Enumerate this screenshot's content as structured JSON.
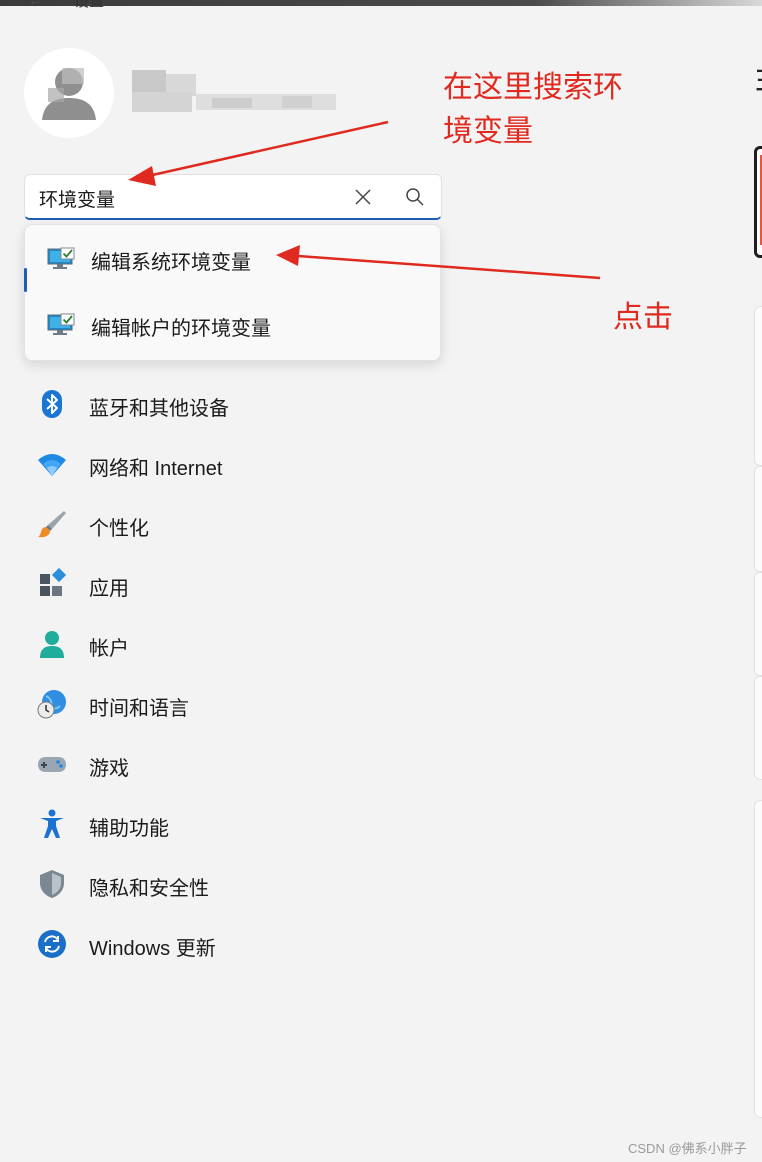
{
  "window": {
    "title": "设置"
  },
  "search": {
    "value": "环境变量"
  },
  "dropdown_results": [
    {
      "label": "编辑系统环境变量",
      "icon": "monitor-check-icon"
    },
    {
      "label": "编辑帐户的环境变量",
      "icon": "monitor-check-icon"
    }
  ],
  "nav": [
    {
      "label": "蓝牙和其他设备",
      "icon": "bluetooth-icon"
    },
    {
      "label": "网络和 Internet",
      "icon": "wifi-icon"
    },
    {
      "label": "个性化",
      "icon": "brush-icon"
    },
    {
      "label": "应用",
      "icon": "apps-icon"
    },
    {
      "label": "帐户",
      "icon": "account-icon"
    },
    {
      "label": "时间和语言",
      "icon": "time-language-icon"
    },
    {
      "label": "游戏",
      "icon": "gamepad-icon"
    },
    {
      "label": "辅助功能",
      "icon": "accessibility-icon"
    },
    {
      "label": "隐私和安全性",
      "icon": "shield-icon"
    },
    {
      "label": "Windows 更新",
      "icon": "update-icon"
    }
  ],
  "annotations": {
    "search_hint": "在这里搜索环境变量",
    "search_hint_line1": "在这里搜索环",
    "search_hint_line2": "境变量",
    "click_hint": "点击"
  },
  "right_edge": {
    "glyph": "ヨ"
  },
  "watermark": "CSDN @佛系小胖子",
  "colors": {
    "accent": "#1a5fb4",
    "annotation": "#e02a20",
    "background": "#f3f3f3"
  }
}
